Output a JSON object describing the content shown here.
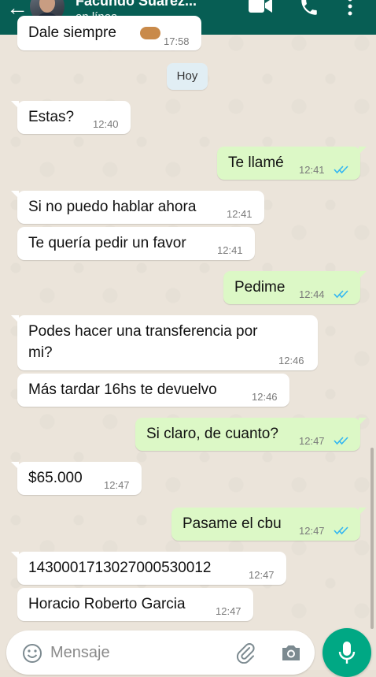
{
  "header": {
    "contact_name": "Facundo Suárez...",
    "status": "en línea",
    "icons": [
      "back-arrow-icon",
      "video-call-icon",
      "voice-call-icon",
      "more-options-icon"
    ]
  },
  "day_separator": "Hoy",
  "messages": [
    {
      "direction": "in",
      "text": "Dale siempre",
      "time": "17:58",
      "emoji": "flexed-biceps"
    },
    {
      "direction": "in",
      "text": "Estas?",
      "time": "12:40"
    },
    {
      "direction": "out",
      "text": "Te llamé",
      "time": "12:41",
      "status": "read"
    },
    {
      "direction": "in",
      "text": "Si no puedo hablar ahora",
      "time": "12:41"
    },
    {
      "direction": "in",
      "text": "Te quería pedir un favor",
      "time": "12:41"
    },
    {
      "direction": "out",
      "text": "Pedime",
      "time": "12:44",
      "status": "read"
    },
    {
      "direction": "in",
      "text_line1": "Podes hacer una transferencia por",
      "text_line2": "mi?",
      "time": "12:46"
    },
    {
      "direction": "in",
      "text": "Más tardar 16hs te devuelvo",
      "time": "12:46"
    },
    {
      "direction": "out",
      "text": "Si claro, de cuanto?",
      "time": "12:47",
      "status": "read"
    },
    {
      "direction": "in",
      "text": "$65.000",
      "time": "12:47"
    },
    {
      "direction": "out",
      "text": "Pasame el cbu",
      "time": "12:47",
      "status": "read"
    },
    {
      "direction": "in",
      "text": "1430001713027000530012",
      "time": "12:47"
    },
    {
      "direction": "in",
      "text": "Horacio Roberto Garcia",
      "time": "12:47"
    }
  ],
  "composer": {
    "placeholder": "Mensaje",
    "icons": [
      "emoji-icon",
      "attach-icon",
      "camera-icon",
      "mic-icon"
    ]
  },
  "colors": {
    "header": "#075e54",
    "outgoing_bubble": "#dcf8c6",
    "incoming_bubble": "#ffffff",
    "read_ticks": "#34b7f1",
    "mic_button": "#00a884",
    "chat_background": "#ebe4da"
  }
}
